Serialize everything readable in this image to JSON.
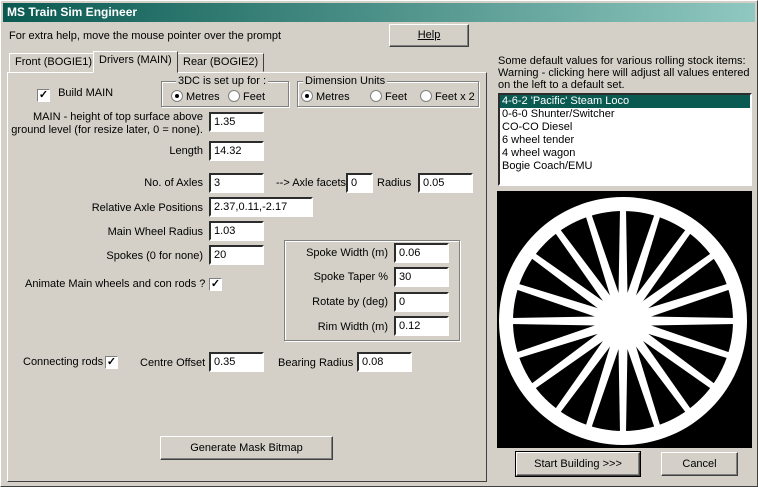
{
  "window": {
    "title": "MS Train Sim Engineer"
  },
  "help_text": "For extra help, move the mouse pointer over the prompt",
  "help_button": "Help",
  "tabs": [
    "Front (BOGIE1)",
    "Drivers (MAIN)",
    "Rear (BOGIE2)"
  ],
  "build_main": {
    "label": "Build MAIN",
    "checked": true
  },
  "setup_3dc": {
    "title": "3DC is set up for :",
    "options": [
      "Metres",
      "Feet"
    ],
    "selected": "Metres"
  },
  "dimension_units": {
    "title": "Dimension Units",
    "options": [
      "Metres",
      "Feet",
      "Feet x 2"
    ],
    "selected": "Metres"
  },
  "fields": {
    "main_height": {
      "label": "MAIN - height of top surface above ground level (for resize later, 0 = none).",
      "value": "1.35"
    },
    "length": {
      "label": "Length",
      "value": "14.32"
    },
    "axles": {
      "label": "No. of Axles",
      "value": "3"
    },
    "axle_facets": {
      "label": "--> Axle facets",
      "value": "0"
    },
    "radius": {
      "label": "Radius",
      "value": "0.05"
    },
    "axle_positions": {
      "label": "Relative Axle Positions",
      "value": "2.37,0.11,-2.17"
    },
    "wheel_radius": {
      "label": "Main Wheel Radius",
      "value": "1.03"
    },
    "spokes": {
      "label": "Spokes (0 for none)",
      "value": "20"
    },
    "spoke_width": {
      "label": "Spoke Width (m)",
      "value": "0.06"
    },
    "spoke_taper": {
      "label": "Spoke Taper %",
      "value": "30"
    },
    "rotate_by": {
      "label": "Rotate by (deg)",
      "value": "0"
    },
    "rim_width": {
      "label": "Rim Width (m)",
      "value": "0.12"
    },
    "centre_offset": {
      "label": "Centre Offset",
      "value": "0.35"
    },
    "bearing_radius": {
      "label": "Bearing Radius",
      "value": "0.08"
    }
  },
  "animate": {
    "label": "Animate Main wheels and con rods ?",
    "checked": true
  },
  "connecting_rods": {
    "label": "Connecting rods",
    "checked": true
  },
  "generate_button": "Generate Mask Bitmap",
  "defaults_text": [
    "Some default values for various rolling stock items:",
    "Warning - clicking here will adjust all values entered",
    "on the left to a default set."
  ],
  "defaults_list": [
    "4-6-2 'Pacific' Steam Loco",
    "0-6-0 Shunter/Switcher",
    "CO-CO Diesel",
    "6 wheel tender",
    "4 wheel wagon",
    "Bogie Coach/EMU"
  ],
  "defaults_selected": 0,
  "start_button": "Start Building >>>",
  "cancel_button": "Cancel",
  "colors": {
    "title_start": "#0a5a52",
    "title_end": "#8fc8c0",
    "selection": "#0a5a52"
  }
}
